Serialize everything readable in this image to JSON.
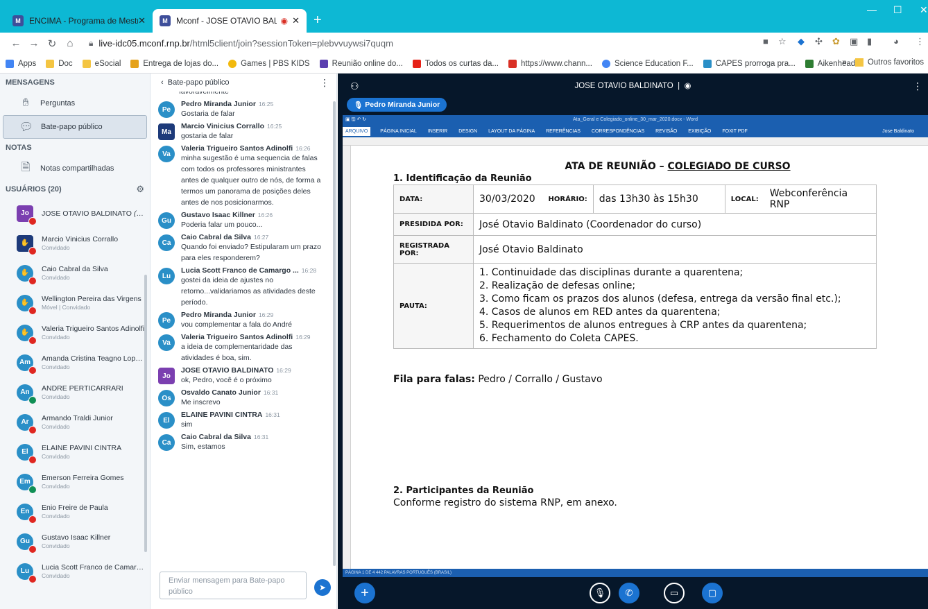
{
  "browser": {
    "tabs": [
      {
        "label": "ENCIMA - Programa de Mestrad...",
        "favicon": "M"
      },
      {
        "label": "Mconf - JOSE OTAVIO BALDI",
        "favicon": "M"
      }
    ],
    "url_host": "live-idc05.mconf.rnp.br",
    "url_path": "/html5client/join?sessionToken=plebvvuywsi7quqm",
    "bookmarks": [
      "Apps",
      "Doc",
      "eSocial",
      "Entrega de lojas do...",
      "Games | PBS KIDS",
      "Reunião online do...",
      "Todos os curtas da...",
      "https://www.chann...",
      "Science Education F...",
      "CAPES prorroga pra...",
      "Aikenhead"
    ],
    "bookmarks_more": "»",
    "other_favorites": "Outros favoritos"
  },
  "sidebar": {
    "messages_title": "MENSAGENS",
    "questions": "Perguntas",
    "public_chat": "Bate-papo público",
    "notes_title": "NOTAS",
    "shared_notes": "Notas compartilhadas",
    "users_title": "USUÁRIOS (20)",
    "users": [
      {
        "initials": "Jo",
        "name": "JOSE OTAVIO BALDINATO",
        "you": "(Você)",
        "role": "",
        "color": "#7b3fb0",
        "square": true,
        "mic": "red"
      },
      {
        "initials": "✋",
        "name": "Marcio Vinicius Corrallo",
        "role": "Convidado",
        "color": "#1d3a7a",
        "square": true,
        "mic": "red"
      },
      {
        "initials": "✋",
        "name": "Caio Cabral da Silva",
        "role": "Convidado",
        "color": "#2a8fc7",
        "square": false,
        "mic": "red"
      },
      {
        "initials": "✋",
        "name": "Wellington Pereira das Virgens",
        "role": "Móvel | Convidado",
        "color": "#2a8fc7",
        "square": false,
        "mic": "red"
      },
      {
        "initials": "✋",
        "name": "Valeria Trigueiro Santos Adinolfi",
        "role": "Convidado",
        "color": "#2a8fc7",
        "square": false,
        "mic": "red"
      },
      {
        "initials": "Am",
        "name": "Amanda Cristina Teagno Lopes ...",
        "role": "Convidado",
        "color": "#2a8fc7",
        "square": false,
        "mic": "red"
      },
      {
        "initials": "An",
        "name": "ANDRE PERTICARRARI",
        "role": "Convidado",
        "color": "#2a8fc7",
        "square": false,
        "mic": "green"
      },
      {
        "initials": "Ar",
        "name": "Armando Traldi Junior",
        "role": "Convidado",
        "color": "#2a8fc7",
        "square": false,
        "mic": "red"
      },
      {
        "initials": "El",
        "name": "ELAINE PAVINI CINTRA",
        "role": "Convidado",
        "color": "#2a8fc7",
        "square": false,
        "mic": "red"
      },
      {
        "initials": "Em",
        "name": "Emerson Ferreira Gomes",
        "role": "Convidado",
        "color": "#2a8fc7",
        "square": false,
        "mic": "green"
      },
      {
        "initials": "En",
        "name": "Enio Freire de Paula",
        "role": "Convidado",
        "color": "#2a8fc7",
        "square": false,
        "mic": "red"
      },
      {
        "initials": "Gu",
        "name": "Gustavo Isaac Killner",
        "role": "Convidado",
        "color": "#2a8fc7",
        "square": false,
        "mic": "red"
      },
      {
        "initials": "Lu",
        "name": "Lucia Scott Franco de Camargo ...",
        "role": "Convidado",
        "color": "#2a8fc7",
        "square": false,
        "mic": "red"
      }
    ]
  },
  "chat": {
    "back_label": "Bate-papo público",
    "partial_top": "favoravelmente",
    "messages": [
      {
        "initials": "Pe",
        "color": "#2a8fc7",
        "square": false,
        "name": "Pedro Miranda Junior",
        "time": "16:25",
        "lines": [
          "Gostaria de falar"
        ]
      },
      {
        "initials": "Ma",
        "color": "#1d3a7a",
        "square": true,
        "name": "Marcio Vinicius Corrallo",
        "time": "16:25",
        "lines": [
          "gostaria de falar"
        ]
      },
      {
        "initials": "Va",
        "color": "#2a8fc7",
        "square": false,
        "name": "Valeria Trigueiro Santos Adinolfi",
        "time": "16:26",
        "lines": [
          "minha sugestão é uma sequencia de falas",
          "com todos os professores ministrantes",
          "antes de qualquer outro de nós, de forma a",
          "termos um panorama de posições deles",
          "antes de nos posicionarmos."
        ]
      },
      {
        "initials": "Gu",
        "color": "#2a8fc7",
        "square": false,
        "name": "Gustavo Isaac Killner",
        "time": "16:26",
        "lines": [
          "Poderia falar um pouco..."
        ]
      },
      {
        "initials": "Ca",
        "color": "#2a8fc7",
        "square": false,
        "name": "Caio Cabral da Silva",
        "time": "16:27",
        "lines": [
          "Quando foi enviado? Estipularam um prazo",
          "para eles responderem?"
        ]
      },
      {
        "initials": "Lu",
        "color": "#2a8fc7",
        "square": false,
        "name": "Lucia Scott Franco de Camargo ...",
        "time": "16:28",
        "lines": [
          "gostei da ideia de ajustes no",
          "retorno...validariamos as atividades deste",
          "período."
        ]
      },
      {
        "initials": "Pe",
        "color": "#2a8fc7",
        "square": false,
        "name": "Pedro Miranda Junior",
        "time": "16:29",
        "lines": [
          "vou complementar a fala do André"
        ]
      },
      {
        "initials": "Va",
        "color": "#2a8fc7",
        "square": false,
        "name": "Valeria Trigueiro Santos Adinolfi",
        "time": "16:29",
        "lines": [
          "a ideia de complementaridade das",
          "atividades é boa, sim."
        ]
      },
      {
        "initials": "Jo",
        "color": "#7b3fb0",
        "square": true,
        "name": "JOSE OTAVIO BALDINATO",
        "time": "16:29",
        "lines": [
          "ok, Pedro, você é o próximo"
        ]
      },
      {
        "initials": "Os",
        "color": "#2a8fc7",
        "square": false,
        "name": "Osvaldo Canato Junior",
        "time": "16:31",
        "lines": [
          "Me inscrevo"
        ]
      },
      {
        "initials": "El",
        "color": "#2a8fc7",
        "square": false,
        "name": "ELAINE PAVINI CINTRA",
        "time": "16:31",
        "lines": [
          "sim"
        ]
      },
      {
        "initials": "Ca",
        "color": "#2a8fc7",
        "square": false,
        "name": "Caio Cabral da Silva",
        "time": "16:31",
        "lines": [
          "Sim, estamos"
        ]
      }
    ],
    "input_placeholder": "Enviar mensagem para Bate-papo público"
  },
  "presentation": {
    "title": "JOSE OTAVIO BALDINATO",
    "talking": "Pedro Miranda Junior",
    "word": {
      "doc_title": "Ata_Geral e Colegiado_online_30_mar_2020.docx - Word",
      "tabs": [
        "ARQUIVO",
        "PÁGINA INICIAL",
        "INSERIR",
        "DESIGN",
        "LAYOUT DA PÁGINA",
        "REFERÊNCIAS",
        "CORRESPONDÊNCIAS",
        "REVISÃO",
        "EXIBIÇÃO",
        "FOXIT PDF"
      ],
      "user": "Jose Baldinato",
      "status": "PÁGINA 1 DE 4    442 PALAVRAS    PORTUGUÊS (BRASIL)"
    },
    "doc": {
      "heading_pre": "ATA DE REUNIÃO – ",
      "heading_u": "COLEGIADO DE CURSO",
      "section1": "1. Identificação da Reunião",
      "data_label": "DATA:",
      "data_value": "30/03/2020",
      "horario_label": "HORÁRIO:",
      "horario_value": "das 13h30 às 15h30",
      "local_label": "LOCAL:",
      "local_value": "Webconferência RNP",
      "presidida_label": "PRESIDIDA POR:",
      "presidida_value": "José Otavio Baldinato (Coordenador do curso)",
      "registrada_label": "REGISTRADA POR:",
      "registrada_value": "José Otavio Baldinato",
      "pauta_label": "PAUTA:",
      "pauta": [
        "1. Continuidade das disciplinas durante a quarentena;",
        "2. Realização de defesas online;",
        "3. Como ficam os prazos dos alunos (defesa, entrega da versão final etc.);",
        "4. Casos de alunos em RED antes da quarentena;",
        "5. Requerimentos de alunos entregues à CRP antes da quarentena;",
        "6. Fechamento do Coleta CAPES."
      ],
      "fila_label": "Fila para falas:",
      "fila_value": " Pedro / Corrallo / Gustavo",
      "section2": "2. Participantes da Reunião",
      "section2_text": "Conforme registro do sistema RNP, em anexo."
    }
  }
}
